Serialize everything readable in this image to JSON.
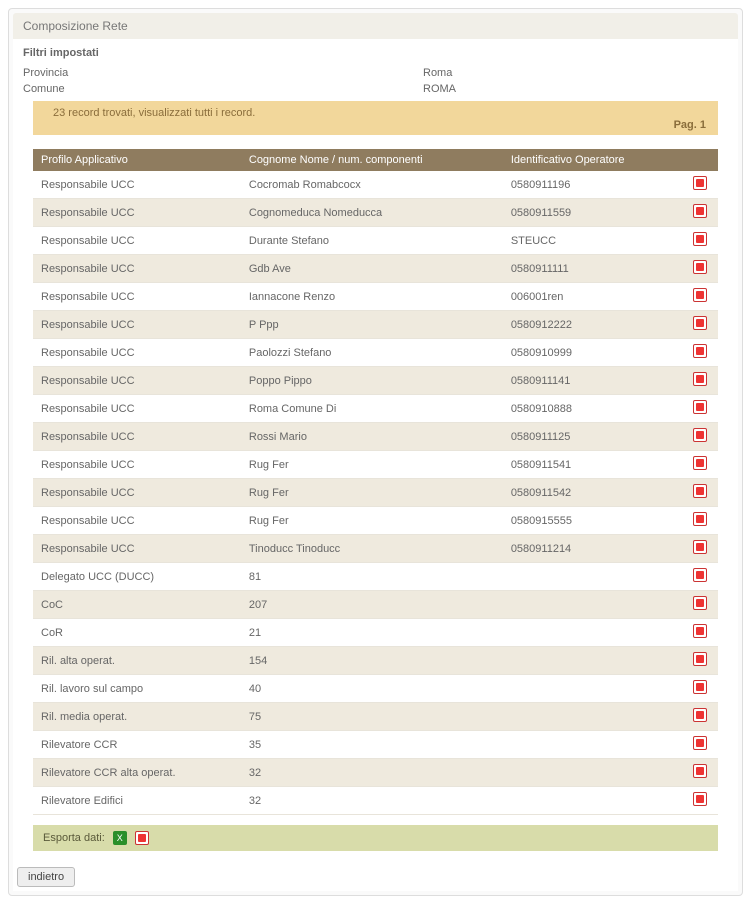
{
  "panel": {
    "title": "Composizione Rete"
  },
  "filters": {
    "heading": "Filtri impostati",
    "rows": [
      {
        "label": "Provincia",
        "value": "Roma"
      },
      {
        "label": "Comune",
        "value": "ROMA"
      }
    ]
  },
  "records_bar": {
    "text": "23 record trovati, visualizzati tutti i record.",
    "pager": "Pag. 1"
  },
  "table": {
    "headers": {
      "profile": "Profilo Applicativo",
      "name": "Cognome Nome / num. componenti",
      "id": "Identificativo Operatore",
      "action": ""
    },
    "rows": [
      {
        "profile": "Responsabile UCC",
        "name": "Cocromab Romabcocx",
        "id": "0580911196"
      },
      {
        "profile": "Responsabile UCC",
        "name": "Cognomeduca Nomeducca",
        "id": "0580911559"
      },
      {
        "profile": "Responsabile UCC",
        "name": "Durante Stefano",
        "id": "STEUCC"
      },
      {
        "profile": "Responsabile UCC",
        "name": "Gdb Ave",
        "id": "0580911111"
      },
      {
        "profile": "Responsabile UCC",
        "name": "Iannacone Renzo",
        "id": "006001ren"
      },
      {
        "profile": "Responsabile UCC",
        "name": "P Ppp",
        "id": "0580912222"
      },
      {
        "profile": "Responsabile UCC",
        "name": "Paolozzi Stefano",
        "id": "0580910999"
      },
      {
        "profile": "Responsabile UCC",
        "name": "Poppo Pippo",
        "id": "0580911141"
      },
      {
        "profile": "Responsabile UCC",
        "name": "Roma Comune Di",
        "id": "0580910888"
      },
      {
        "profile": "Responsabile UCC",
        "name": "Rossi Mario",
        "id": "0580911125"
      },
      {
        "profile": "Responsabile UCC",
        "name": "Rug Fer",
        "id": "0580911541"
      },
      {
        "profile": "Responsabile UCC",
        "name": "Rug Fer",
        "id": "0580911542"
      },
      {
        "profile": "Responsabile UCC",
        "name": "Rug Fer",
        "id": "0580915555"
      },
      {
        "profile": "Responsabile UCC",
        "name": "Tinoducc Tinoducc",
        "id": "0580911214"
      },
      {
        "profile": "Delegato UCC (DUCC)",
        "name": "81",
        "id": ""
      },
      {
        "profile": "CoC",
        "name": "207",
        "id": ""
      },
      {
        "profile": "CoR",
        "name": "21",
        "id": ""
      },
      {
        "profile": "Ril. alta operat.",
        "name": "154",
        "id": ""
      },
      {
        "profile": "Ril. lavoro sul campo",
        "name": "40",
        "id": ""
      },
      {
        "profile": "Ril. media operat.",
        "name": "75",
        "id": ""
      },
      {
        "profile": "Rilevatore CCR",
        "name": "35",
        "id": ""
      },
      {
        "profile": "Rilevatore CCR alta operat.",
        "name": "32",
        "id": ""
      },
      {
        "profile": "Rilevatore Edifici",
        "name": "32",
        "id": ""
      }
    ]
  },
  "export": {
    "label": "Esporta dati:"
  },
  "footer": {
    "back_label": "indietro"
  }
}
